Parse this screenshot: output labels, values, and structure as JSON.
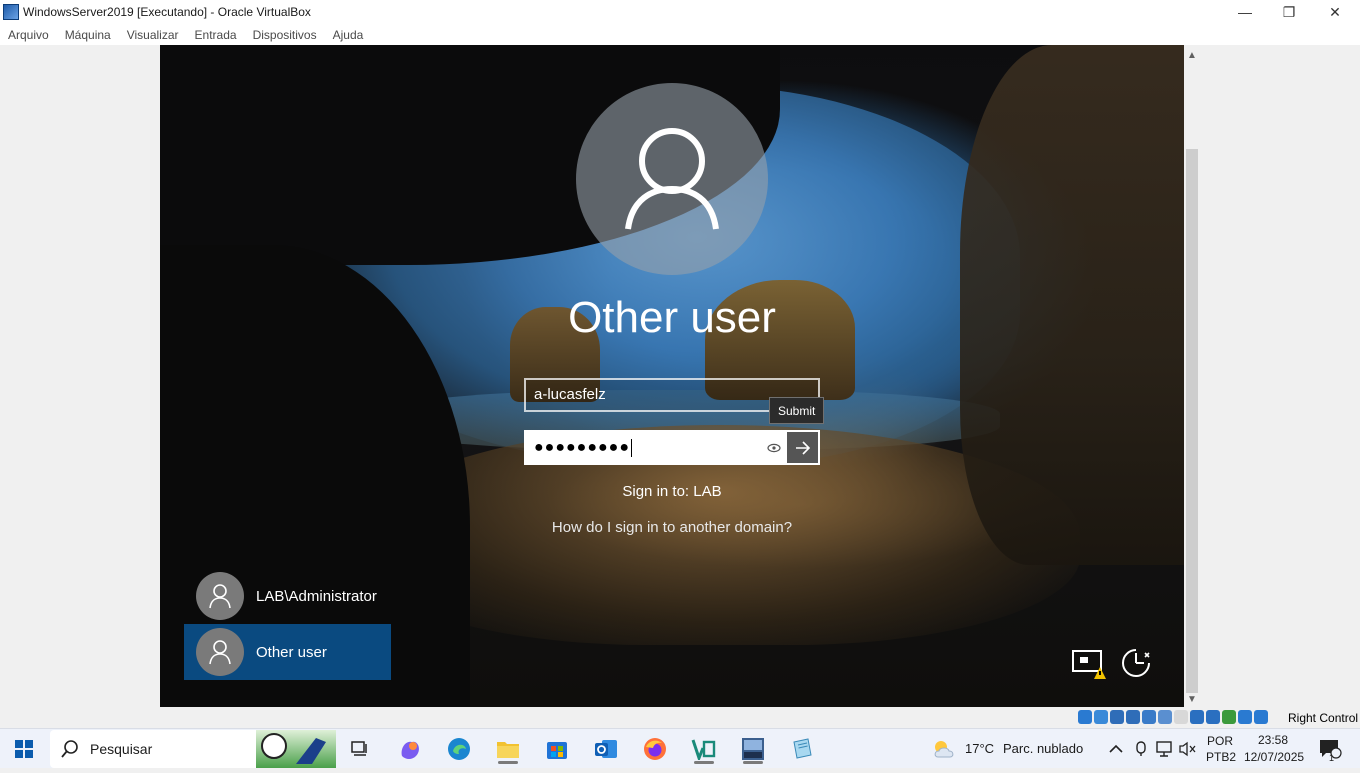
{
  "window": {
    "title": "WindowsServer2019 [Executando] - Oracle VirtualBox",
    "minimize_glyph": "—",
    "restore_glyph": "❐",
    "close_glyph": "✕"
  },
  "menu": [
    "Arquivo",
    "Máquina",
    "Visualizar",
    "Entrada",
    "Dispositivos",
    "Ajuda"
  ],
  "login": {
    "display_name": "Other user",
    "username_value": "a-lucasfelz",
    "password_mask": "●●●●●●●●●",
    "submit_tooltip": "Submit",
    "sign_in_to": "Sign in to: LAB",
    "other_domain_link": "How do I sign in to another domain?"
  },
  "user_tiles": [
    {
      "label": "LAB\\Administrator",
      "selected": false
    },
    {
      "label": "Other user",
      "selected": true
    }
  ],
  "corner_icons": [
    "network-warning-icon",
    "accessibility-icon"
  ],
  "status_bar": {
    "right_control": "Right Control"
  },
  "taskbar": {
    "search_placeholder": "Pesquisar",
    "weather_temp": "17°C",
    "weather_desc": "Parc. nublado",
    "lang_top": "POR",
    "lang_bottom": "PTB2",
    "time": "23:58",
    "date": "12/07/2025",
    "notification_count": "1"
  },
  "colors": {
    "selected_tile": "#0a4a80",
    "taskbar_bg": "#eef2fa"
  }
}
